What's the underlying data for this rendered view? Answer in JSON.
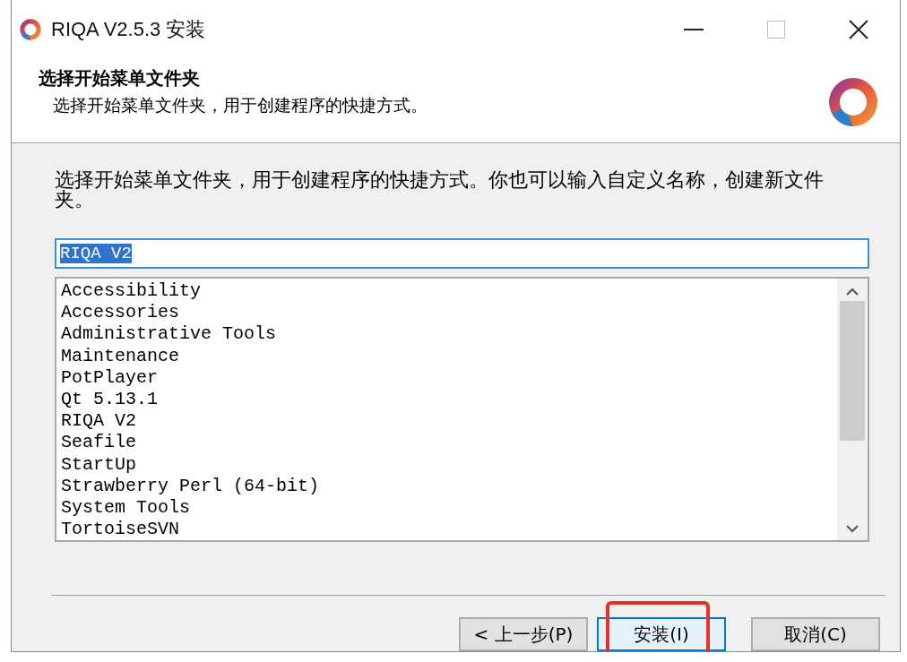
{
  "window": {
    "title": "RIQA V2.5.3 安装"
  },
  "header": {
    "title": "选择开始菜单文件夹",
    "subtitle": "选择开始菜单文件夹，用于创建程序的快捷方式。"
  },
  "description": "选择开始菜单文件夹，用于创建程序的快捷方式。你也可以输入自定义名称，创建新文件夹。",
  "folder_field": {
    "value": "RIQA V2",
    "text_selected": true
  },
  "folder_list": {
    "items": [
      {
        "label": "Accessibility"
      },
      {
        "label": "Accessories"
      },
      {
        "label": "Administrative Tools"
      },
      {
        "label": "Maintenance"
      },
      {
        "label": "PotPlayer"
      },
      {
        "label": "Qt 5.13.1"
      },
      {
        "label": "RIQA V2"
      },
      {
        "label": "Seafile"
      },
      {
        "label": "StartUp"
      },
      {
        "label": "Strawberry Perl (64-bit)"
      },
      {
        "label": "System Tools"
      },
      {
        "label": "TortoiseSVN"
      }
    ]
  },
  "buttons": [
    {
      "label": "< 上一步(P)",
      "default": false,
      "highlighted": false
    },
    {
      "label": "安装(I)",
      "default": true,
      "highlighted": true
    },
    {
      "label": "取消(C)",
      "default": false,
      "highlighted": false
    }
  ]
}
